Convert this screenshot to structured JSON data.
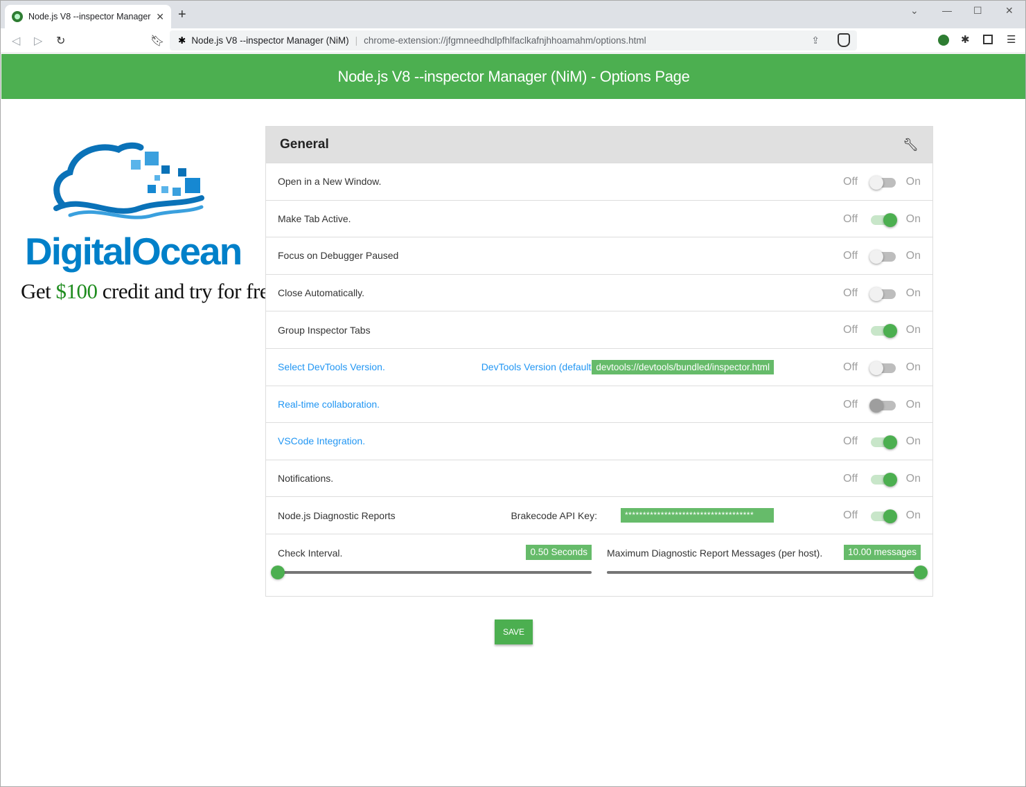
{
  "browser": {
    "tab_title": "Node.js V8 --inspector Manager (",
    "tab_close": "✕",
    "new_tab": "+",
    "window_controls": [
      "⌄",
      "—",
      "☐",
      "✕"
    ],
    "extension_name": "Node.js V8 --inspector Manager (NiM)",
    "url": "chrome-extension://jfgmneedhdlpfhlfaclkafnjhhoamahm/options.html"
  },
  "header": {
    "title": "Node.js V8 --inspector Manager (NiM) - Options Page"
  },
  "ad": {
    "brand": "DigitalOcean",
    "tagline_before": "Get ",
    "tagline_money": "$100",
    "tagline_after": " credit and try for free!"
  },
  "panel": {
    "title": "General",
    "icon": "wrench-icon",
    "switch_off_label": "Off",
    "switch_on_label": "On",
    "rows": [
      {
        "label": "Open in a New Window.",
        "checked": false
      },
      {
        "label": "Make Tab Active.",
        "checked": true
      },
      {
        "label": "Focus on Debugger Paused",
        "checked": false
      },
      {
        "label": "Close Automatically.",
        "checked": false
      },
      {
        "label": "Group Inspector Tabs",
        "checked": true
      },
      {
        "label": "Select DevTools Version.",
        "checked": false,
        "mid_label": "DevTools Version (default):",
        "chip": "devtools://devtools/bundled/inspector.html"
      },
      {
        "label": "Real-time collaboration.",
        "checked": false
      },
      {
        "label": "VSCode Integration.",
        "checked": true
      },
      {
        "label": "Notifications.",
        "checked": true
      },
      {
        "label": "Node.js Diagnostic Reports",
        "checked": true,
        "mid_label": "Brakecode API Key:",
        "chip": "************************************"
      }
    ],
    "sliders": [
      {
        "label": "Check Interval.",
        "value_text": "0.50 Seconds",
        "fraction": 0.0
      },
      {
        "label": "Maximum Diagnostic Report Messages (per host).",
        "value_text": "10.00 messages",
        "fraction": 1.0
      }
    ]
  },
  "save_label": "SAVE",
  "colors": {
    "accent": "#4caf50",
    "chip": "#66bb6a",
    "link": "#2196f3",
    "brand_blue": "#0080c9"
  }
}
